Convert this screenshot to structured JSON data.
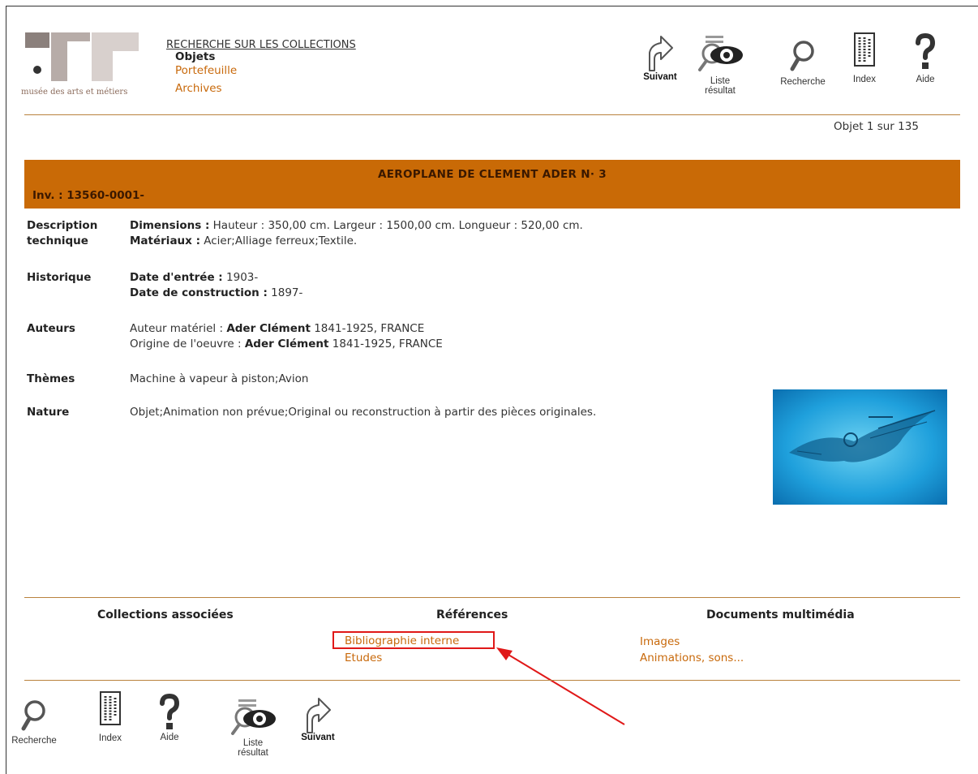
{
  "logo": {
    "text": "musée des arts et métiers"
  },
  "header_nav": {
    "collections_link": "RECHERCHE SUR LES COLLECTIONS",
    "objets": "Objets",
    "portefeuille": "Portefeuille",
    "archives": "Archives"
  },
  "toolbar_top": {
    "suivant": "Suivant",
    "liste_resultat_1": "Liste",
    "liste_resultat_2": "résultat",
    "recherche": "Recherche",
    "index": "Index",
    "aide": "Aide"
  },
  "counter": "Objet 1 sur 135",
  "object": {
    "title": "AEROPLANE DE CLEMENT ADER N· 3",
    "inv": "Inv. : 13560-0001-"
  },
  "details": {
    "description_label_1": "Description",
    "description_label_2": "technique",
    "dimensions_key": "Dimensions :",
    "dimensions_val": " Hauteur : 350,00 cm. Largeur : 1500,00 cm. Longueur : 520,00 cm.",
    "materiaux_key": "Matériaux :",
    "materiaux_val": " Acier;Alliage ferreux;Textile.",
    "historique_label": "Historique",
    "date_entree_key": "Date d'entrée :",
    "date_entree_val": " 1903-",
    "date_construction_key": "Date de construction :",
    "date_construction_val": " 1897-",
    "auteurs_label": "Auteurs",
    "auteur1_role": "Auteur matériel : ",
    "auteur1_name": "Ader Clément",
    "auteur1_rest": " 1841-1925, FRANCE",
    "auteur2_role": "Origine de l'oeuvre : ",
    "auteur2_name": "Ader Clément",
    "auteur2_rest": " 1841-1925, FRANCE",
    "themes_label": "Thèmes",
    "themes_val": "Machine à vapeur à piston;Avion",
    "nature_label": "Nature",
    "nature_val": "Objet;Animation non prévue;Original ou reconstruction à partir des pièces originales."
  },
  "sections": {
    "collections_associees": "Collections associées",
    "references": "Références",
    "documents": "Documents multimédia",
    "bibliographie": "Bibliographie interne",
    "etudes": "Etudes",
    "images": "Images",
    "animations": "Animations, sons..."
  },
  "toolbar_bottom": {
    "recherche": "Recherche",
    "index": "Index",
    "aide": "Aide",
    "liste_resultat_1": "Liste",
    "liste_resultat_2": "résultat",
    "suivant": "Suivant"
  },
  "colors": {
    "accent": "#c96a06",
    "link": "#c8690b",
    "annotation": "#e01818"
  }
}
